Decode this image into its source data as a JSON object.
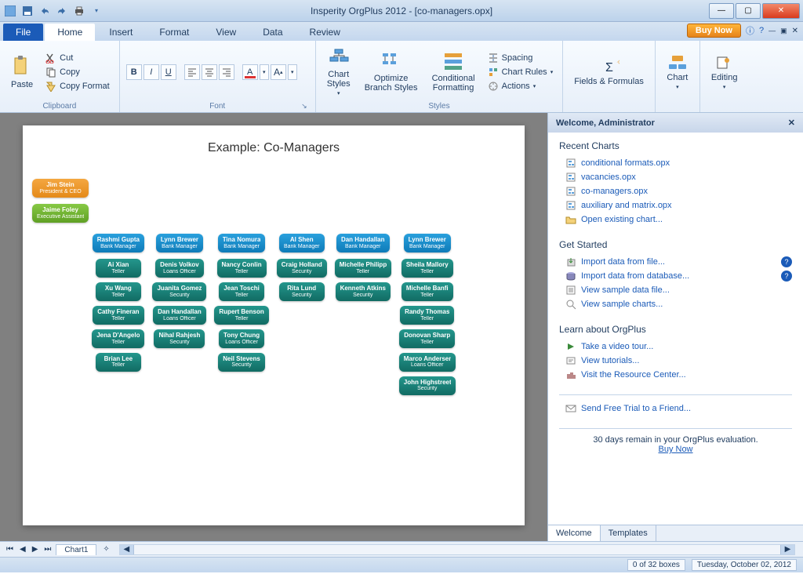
{
  "title": "Insperity OrgPlus 2012 - [co-managers.opx]",
  "qat": {
    "save": "save-icon",
    "undo": "undo-icon",
    "redo": "redo-icon",
    "print": "print-icon"
  },
  "tabs": {
    "file": "File",
    "items": [
      "Home",
      "Insert",
      "Format",
      "View",
      "Data",
      "Review"
    ],
    "active": 0
  },
  "buy_now": "Buy Now",
  "ribbon": {
    "clipboard": {
      "label": "Clipboard",
      "paste": "Paste",
      "cut": "Cut",
      "copy": "Copy",
      "copy_format": "Copy Format"
    },
    "font": {
      "label": "Font"
    },
    "styles": {
      "label": "Styles",
      "chart_styles": "Chart\nStyles",
      "optimize": "Optimize\nBranch Styles",
      "conditional": "Conditional\nFormatting",
      "spacing": "Spacing",
      "chart_rules": "Chart Rules",
      "actions": "Actions"
    },
    "fields": {
      "label": "Fields & Formulas"
    },
    "chart": {
      "label": "Chart"
    },
    "editing": {
      "label": "Editing"
    }
  },
  "canvas": {
    "chart_title": "Example: Co-Managers"
  },
  "org": {
    "ceo": {
      "name": "Jim Stein",
      "role": "President & CEO"
    },
    "ea": {
      "name": "Jaime Foley",
      "role": "Executive Assistant"
    },
    "managers": [
      {
        "name": "Rashmi Gupta",
        "role": "Bank Manager",
        "reports": [
          {
            "col1": [
              {
                "name": "Ai Xian",
                "role": "Teller"
              },
              {
                "name": "Xu Wang",
                "role": "Teller"
              },
              {
                "name": "Cathy Fineran",
                "role": "Teller"
              },
              {
                "name": "Jena D'Angelo",
                "role": "Teller"
              },
              {
                "name": "Brian Lee",
                "role": "Teller"
              }
            ]
          }
        ]
      },
      {
        "name": "Lynn Brewer",
        "role": "Bank Manager",
        "reports": [
          {
            "col1": [
              {
                "name": "Denis Volkov",
                "role": "Loans Officer"
              },
              {
                "name": "Juanita Gomez",
                "role": "Security"
              },
              {
                "name": "Dan Handallan",
                "role": "Loans Officer"
              },
              {
                "name": "Nihal Rahjesh",
                "role": "Security"
              }
            ]
          }
        ]
      },
      {
        "name": "Tina Nomura",
        "role": "Bank Manager",
        "reports": [
          {
            "col1": [
              {
                "name": "Nancy Conlin",
                "role": "Teller"
              },
              {
                "name": "Jean Toschi",
                "role": "Teller"
              },
              {
                "name": "Rupert Benson",
                "role": "Teller"
              },
              {
                "name": "Tony Chung",
                "role": "Loans Officer"
              },
              {
                "name": "Neil Stevens",
                "role": "Security"
              }
            ]
          }
        ]
      },
      {
        "name": "Al Shen",
        "role": "Bank Manager",
        "reports": [
          {
            "col1": [
              {
                "name": "Craig Holland",
                "role": "Security"
              },
              {
                "name": "Rita Lund",
                "role": "Security"
              }
            ]
          }
        ]
      },
      {
        "name": "Dan Handallan",
        "role": "Bank Manager",
        "reports": [
          {
            "col1": [
              {
                "name": "Michelle Philippi",
                "role": "Teller"
              },
              {
                "name": "Kenneth Atkins",
                "role": "Security"
              }
            ]
          }
        ]
      },
      {
        "name": "Lynn Brewer",
        "role": "Bank Manager",
        "reports": [
          {
            "col1": [
              {
                "name": "Sheila Mallory",
                "role": "Teller"
              },
              {
                "name": "Michelle Banfi",
                "role": "Teller"
              },
              {
                "name": "Randy Thomas",
                "role": "Teller"
              },
              {
                "name": "Donovan Sharp",
                "role": "Teller"
              },
              {
                "name": "Marco Andersen",
                "role": "Loans Officer"
              },
              {
                "name": "John Highstreet",
                "role": "Security"
              }
            ]
          }
        ]
      }
    ]
  },
  "panel": {
    "welcome": "Welcome, Administrator",
    "recent": {
      "title": "Recent Charts",
      "items": [
        "conditional formats.opx",
        "vacancies.opx",
        "co-managers.opx",
        "auxiliary and matrix.opx"
      ],
      "open": "Open existing chart..."
    },
    "get_started": {
      "title": "Get Started",
      "import_file": "Import data from file...",
      "import_db": "Import data from database...",
      "sample_data": "View sample data file...",
      "sample_charts": "View sample charts..."
    },
    "learn": {
      "title": "Learn about OrgPlus",
      "video": "Take a video tour...",
      "tutorials": "View tutorials...",
      "resource": "Visit the Resource Center..."
    },
    "send_trial": "Send Free Trial to a Friend...",
    "eval": {
      "text": "30 days remain in your OrgPlus evaluation.",
      "buy": "Buy Now"
    },
    "tabs": {
      "welcome": "Welcome",
      "templates": "Templates"
    }
  },
  "sheet": {
    "tab": "Chart1"
  },
  "status": {
    "boxes": "0 of 32 boxes",
    "date": "Tuesday, October 02, 2012"
  }
}
